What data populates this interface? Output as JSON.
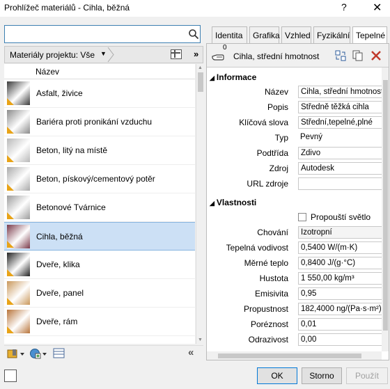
{
  "window": {
    "title": "Prohlížeč materiálů - Cihla, běžná",
    "help_label": "?",
    "close_label": "✕"
  },
  "search": {
    "value": "",
    "placeholder": ""
  },
  "filter": {
    "label": "Materiály projektu: Vše",
    "expand_label": "»"
  },
  "list": {
    "column_header": "Název",
    "items": [
      {
        "name": "Asfalt, živice",
        "color": "#3a3a3a",
        "selected": false
      },
      {
        "name": "Bariéra proti pronikání vzduchu",
        "color": "#8a8a8a",
        "selected": false
      },
      {
        "name": "Beton, litý na místě",
        "color": "#b8b8b8",
        "selected": false
      },
      {
        "name": "Beton, pískový/cementový potěr",
        "color": "#a9a9a9",
        "selected": false
      },
      {
        "name": "Betonové Tvárnice",
        "color": "#9c9c9c",
        "selected": false
      },
      {
        "name": "Cihla, běžná",
        "color": "#7a3a4a",
        "selected": true
      },
      {
        "name": "Dveře, klika",
        "color": "#222222",
        "selected": false
      },
      {
        "name": "Dveře, panel",
        "color": "#c9975a",
        "selected": false
      },
      {
        "name": "Dveře, rám",
        "color": "#b8743a",
        "selected": false
      }
    ],
    "collapse_label": "«"
  },
  "tabs": [
    {
      "label": "Identita",
      "active": false
    },
    {
      "label": "Grafika",
      "active": false
    },
    {
      "label": "Vzhled",
      "active": false
    },
    {
      "label": "Fyzikální",
      "active": false
    },
    {
      "label": "Tepelné",
      "active": true
    }
  ],
  "asset": {
    "usage_count": "0",
    "name": "Cihla, střední hmotnost"
  },
  "sections": {
    "info_title": "Informace",
    "props_title": "Vlastnosti"
  },
  "info": {
    "nazev_label": "Název",
    "nazev_value": "Cihla, střední hmotnost",
    "popis_label": "Popis",
    "popis_value": "Středně těžká cihla",
    "klic_label": "Klíčová slova",
    "klic_value": "Střední,tepelné,plné",
    "typ_label": "Typ",
    "typ_value": "Pevný",
    "podtrida_label": "Podtřída",
    "podtrida_value": "Zdivo",
    "zdroj_label": "Zdroj",
    "zdroj_value": "Autodesk",
    "url_label": "URL zdroje",
    "url_value": ""
  },
  "properties": {
    "light_label": "Propouští světlo",
    "light_checked": false,
    "chovani_label": "Chování",
    "chovani_value": "Izotropní",
    "vodivost_label": "Tepelná vodivost",
    "vodivost_value": "0,5400 W/(m·K)",
    "teplo_label": "Měrné teplo",
    "teplo_value": "0,8400 J/(g·°C)",
    "hustota_label": "Hustota",
    "hustota_value": "1 550,00 kg/m³",
    "emisivita_label": "Emisivita",
    "emisivita_value": "0,95",
    "propustnost_label": "Propustnost",
    "propustnost_value": "182,4000 ng/(Pa·s·m²)",
    "porez_label": "Poréznost",
    "porez_value": "0,01",
    "odraz_label": "Odrazivost",
    "odraz_value": "0,00"
  },
  "footer": {
    "ok_label": "OK",
    "cancel_label": "Storno",
    "apply_label": "Použít"
  }
}
